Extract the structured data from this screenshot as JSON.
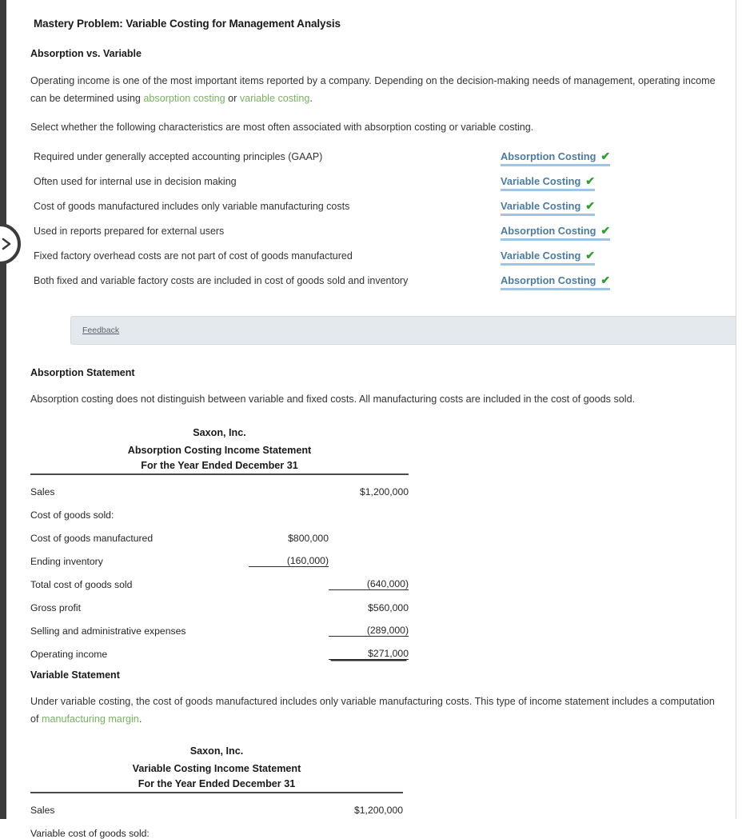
{
  "page_title": "Mastery Problem: Variable Costing for Management Analysis",
  "section1": {
    "heading": "Absorption vs. Variable",
    "paragraph_a": "Operating income is one of the most important items reported by a company. Depending on the decision-making needs of management, operating income can be determined using ",
    "link_absorption": "absorption costing",
    "paragraph_b": " or ",
    "link_variable": "variable costing",
    "paragraph_c": ".",
    "instruction": "Select whether the following characteristics are most often associated with absorption costing or variable costing.",
    "rows": [
      {
        "label": "Required under generally accepted accounting principles (GAAP)",
        "answer": "Absorption Costing",
        "mark": "✔"
      },
      {
        "label": "Often used for internal use in decision making",
        "answer": "Variable Costing",
        "mark": "✔"
      },
      {
        "label": "Cost of goods manufactured includes only variable manufacturing costs",
        "answer": "Variable Costing",
        "mark": "✔"
      },
      {
        "label": "Used in reports prepared for external users",
        "answer": "Absorption Costing",
        "mark": "✔"
      },
      {
        "label": "Fixed factory overhead costs are not part of cost of goods manufactured",
        "answer": "Variable Costing",
        "mark": "✔"
      },
      {
        "label": "Both fixed and variable factory costs are included in cost of goods sold and inventory",
        "answer": "Absorption Costing",
        "mark": "✔"
      }
    ]
  },
  "feedback": {
    "label": "Feedback"
  },
  "section2": {
    "heading": "Absorption Statement",
    "paragraph": "Absorption costing does not distinguish between variable and fixed costs. All manufacturing costs are included in the cost of goods sold.",
    "statement": {
      "company": "Saxon, Inc.",
      "title": "Absorption Costing Income Statement",
      "period": "For the Year Ended December 31",
      "rows": [
        {
          "label": "Sales",
          "indent": 0,
          "col1": "",
          "col2": "$1,200,000",
          "rule1": "",
          "rule2": ""
        },
        {
          "label": "Cost of goods sold:",
          "indent": 0,
          "col1": "",
          "col2": "",
          "rule1": "",
          "rule2": ""
        },
        {
          "label": "Cost of goods manufactured",
          "indent": 1,
          "col1": "$800,000",
          "col2": "",
          "rule1": "",
          "rule2": ""
        },
        {
          "label": "Ending inventory",
          "indent": 1,
          "col1": "(160,000)",
          "col2": "",
          "rule1": "single",
          "rule2": ""
        },
        {
          "label": "Total cost of goods sold",
          "indent": 2,
          "col1": "",
          "col2": "(640,000)",
          "rule1": "",
          "rule2": "single"
        },
        {
          "label": "Gross profit",
          "indent": 0,
          "col1": "",
          "col2": "$560,000",
          "rule1": "",
          "rule2": ""
        },
        {
          "label": "Selling and administrative expenses",
          "indent": 0,
          "col1": "",
          "col2": "(289,000)",
          "rule1": "",
          "rule2": "single"
        },
        {
          "label": "Operating income",
          "indent": 0,
          "col1": "",
          "col2": "$271,000",
          "rule1": "",
          "rule2": "double"
        }
      ]
    }
  },
  "section3": {
    "heading": "Variable Statement",
    "paragraph_a": "Under variable costing, the cost of goods manufactured includes only variable manufacturing costs. This type of income statement includes a computation of ",
    "link_margin": "manufacturing margin",
    "paragraph_b": ".",
    "statement": {
      "company": "Saxon, Inc.",
      "title": "Variable Costing Income Statement",
      "period": "For the Year Ended December 31",
      "rows": [
        {
          "label": "Sales",
          "indent": 0,
          "col1": "",
          "col2": "$1,200,000",
          "rule1": "",
          "rule2": ""
        },
        {
          "label": "Variable cost of goods sold:",
          "indent": 0,
          "col1": "",
          "col2": "",
          "rule1": "",
          "rule2": ""
        }
      ]
    }
  },
  "icons": {
    "expand_handle": "chevron-right-icon",
    "collapse": "triangle-up-icon"
  }
}
